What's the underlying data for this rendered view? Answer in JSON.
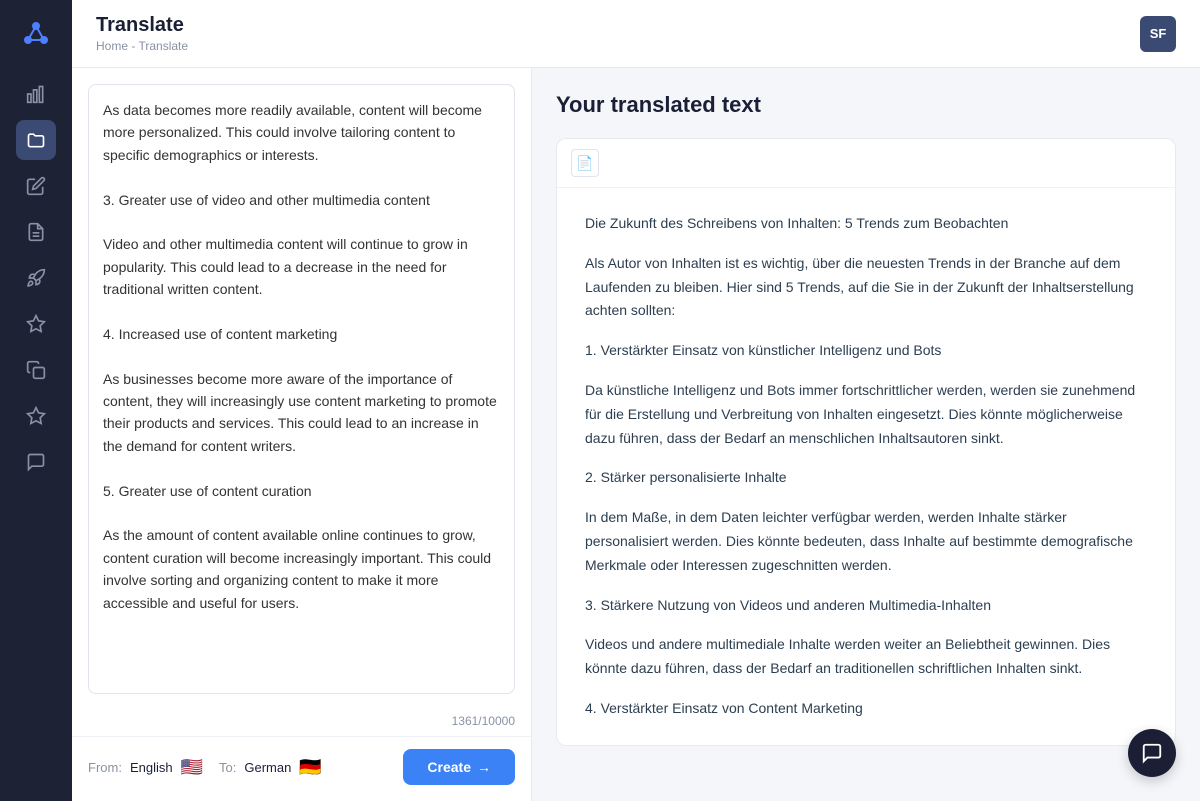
{
  "app": {
    "logo_symbol": "⬡",
    "title": "Translate",
    "breadcrumb_home": "Home",
    "breadcrumb_separator": "-",
    "breadcrumb_current": "Translate",
    "user_initials": "SF"
  },
  "sidebar": {
    "items": [
      {
        "name": "analytics-icon",
        "symbol": "📊",
        "active": false
      },
      {
        "name": "folder-icon",
        "symbol": "📁",
        "active": true
      },
      {
        "name": "edit-icon",
        "symbol": "✏️",
        "active": false
      },
      {
        "name": "document-icon",
        "symbol": "📄",
        "active": false
      },
      {
        "name": "rocket-icon",
        "symbol": "🚀",
        "active": false
      },
      {
        "name": "star-icon",
        "symbol": "⭐",
        "active": false
      },
      {
        "name": "copy-icon",
        "symbol": "📋",
        "active": false
      },
      {
        "name": "bookmark-icon",
        "symbol": "🔖",
        "active": false
      },
      {
        "name": "chat-icon",
        "symbol": "💬",
        "active": false
      }
    ]
  },
  "left_panel": {
    "textarea_content": "As data becomes more readily available, content will become more personalized. This could involve tailoring content to specific demographics or interests.\n\n3. Greater use of video and other multimedia content\n\nVideo and other multimedia content will continue to grow in popularity. This could lead to a decrease in the need for traditional written content.\n\n4. Increased use of content marketing\n\nAs businesses become more aware of the importance of content, they will increasingly use content marketing to promote their products and services. This could lead to an increase in the demand for content writers.\n\n5. Greater use of content curation\n\nAs the amount of content available online continues to grow, content curation will become increasingly important. This could involve sorting and organizing content to make it more accessible and useful for users.",
    "char_count": "1361/10000",
    "from_label": "From:",
    "from_lang": "English",
    "from_flag": "🇺🇸",
    "to_label": "To:",
    "to_lang": "German",
    "to_flag": "🇩🇪",
    "create_button": "Create",
    "create_arrow": "→"
  },
  "right_panel": {
    "title": "Your translated text",
    "toolbar_icon": "📄",
    "paragraphs": [
      "Die Zukunft des Schreibens von Inhalten: 5 Trends zum Beobachten",
      "Als Autor von Inhalten ist es wichtig, über die neuesten Trends in der Branche auf dem Laufenden zu bleiben. Hier sind 5 Trends, auf die Sie in der Zukunft der Inhaltserstellung achten sollten:",
      "1. Verstärkter Einsatz von künstlicher Intelligenz und Bots",
      "Da künstliche Intelligenz und Bots immer fortschrittlicher werden, werden sie zunehmend für die Erstellung und Verbreitung von Inhalten eingesetzt. Dies könnte möglicherweise dazu führen, dass der Bedarf an menschlichen Inhaltsautoren sinkt.",
      "2. Stärker personalisierte Inhalte",
      "In dem Maße, in dem Daten leichter verfügbar werden, werden Inhalte stärker personalisiert werden. Dies könnte bedeuten, dass Inhalte auf bestimmte demografische Merkmale oder Interessen zugeschnitten werden.",
      "3. Stärkere Nutzung von Videos und anderen Multimedia-Inhalten",
      "Videos und andere multimediale Inhalte werden weiter an Beliebtheit gewinnen. Dies könnte dazu führen, dass der Bedarf an traditionellen schriftlichen Inhalten sinkt.",
      "4. Verstärkter Einsatz von Content Marketing"
    ]
  },
  "chat_bubble": {
    "symbol": "💬"
  }
}
